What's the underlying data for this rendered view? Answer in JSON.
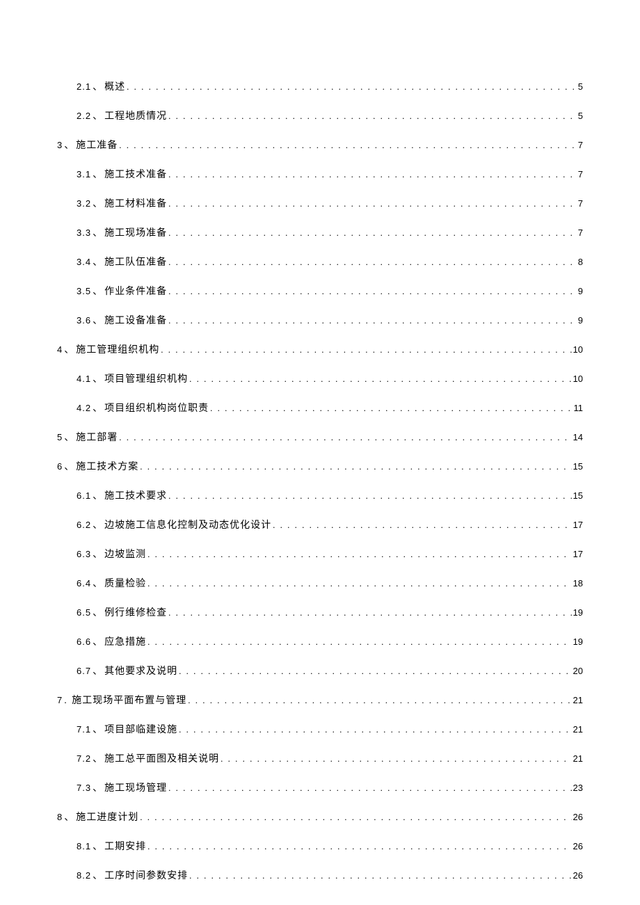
{
  "toc": [
    {
      "level": 2,
      "num": "2.1",
      "sep": "、",
      "title": "概述",
      "page": "5"
    },
    {
      "level": 2,
      "num": "2.2",
      "sep": "、",
      "title": "工程地质情况",
      "page": "5"
    },
    {
      "level": 1,
      "num": "3",
      "sep": "、",
      "title": "施工准备",
      "page": "7"
    },
    {
      "level": 2,
      "num": "3.1",
      "sep": "、",
      "title": "施工技术准备",
      "page": "7"
    },
    {
      "level": 2,
      "num": "3.2",
      "sep": "、",
      "title": "施工材料准备",
      "page": "7"
    },
    {
      "level": 2,
      "num": "3.3",
      "sep": "、",
      "title": "施工现场准备",
      "page": "7"
    },
    {
      "level": 2,
      "num": "3.4",
      "sep": "、",
      "title": "施工队伍准备",
      "page": "8"
    },
    {
      "level": 2,
      "num": "3.5",
      "sep": "、",
      "title": "作业条件准备",
      "page": "9"
    },
    {
      "level": 2,
      "num": "3.6",
      "sep": "、",
      "title": "施工设备准备",
      "page": "9"
    },
    {
      "level": 1,
      "num": "4",
      "sep": "、",
      "title": "施工管理组织机构",
      "page": "10"
    },
    {
      "level": 2,
      "num": "4.1",
      "sep": "、",
      "title": "项目管理组织机构",
      "page": "10"
    },
    {
      "level": 2,
      "num": "4.2",
      "sep": "、",
      "title": "项目组织机构岗位职责",
      "page": "11"
    },
    {
      "level": 1,
      "num": "5",
      "sep": "、",
      "title": "施工部署",
      "page": "14"
    },
    {
      "level": 1,
      "num": "6",
      "sep": "、",
      "title": "施工技术方案",
      "page": "15"
    },
    {
      "level": 2,
      "num": "6.1",
      "sep": "、",
      "title": "施工技术要求",
      "page": "15"
    },
    {
      "level": 2,
      "num": "6.2",
      "sep": "、",
      "title": "边坡施工信息化控制及动态优化设计",
      "page": "17"
    },
    {
      "level": 2,
      "num": "6.3",
      "sep": "、",
      "title": "边坡监测",
      "page": "17"
    },
    {
      "level": 2,
      "num": "6.4",
      "sep": "、",
      "title": "质量检验",
      "page": "18"
    },
    {
      "level": 2,
      "num": "6.5",
      "sep": "、",
      "title": "例行维修检查",
      "page": "19"
    },
    {
      "level": 2,
      "num": "6.6",
      "sep": "、",
      "title": "应急措施",
      "page": "19"
    },
    {
      "level": 2,
      "num": "6.7",
      "sep": "、",
      "title": "其他要求及说明",
      "page": "20"
    },
    {
      "level": 1,
      "num": "7",
      "sep": ".",
      "title": "施工现场平面布置与管理",
      "page": "21"
    },
    {
      "level": 2,
      "num": "7.1",
      "sep": "、",
      "title": "项目部临建设施",
      "page": "21"
    },
    {
      "level": 2,
      "num": "7.2",
      "sep": "、",
      "title": "施工总平面图及相关说明",
      "page": "21"
    },
    {
      "level": 2,
      "num": "7.3",
      "sep": "、",
      "title": "施工现场管理",
      "page": "23"
    },
    {
      "level": 1,
      "num": "8",
      "sep": "、",
      "title": "施工进度计划",
      "page": "26"
    },
    {
      "level": 2,
      "num": "8.1",
      "sep": "、",
      "title": "工期安排",
      "page": "26"
    },
    {
      "level": 2,
      "num": "8.2",
      "sep": "、",
      "title": "工序时间参数安排",
      "page": "26"
    }
  ],
  "dots": ". . . . . . . . . . . . . . . . . . . . . . . . . . . . . . . . . . . . . . . . . . . . . . . . . . . . . . . . . . . . . . . . . . . . . . . . . . . . . . . . . . . . . . . . . . . . . . . . . . . . . . . . . . . . . . . . . . . . . . . . . . . . . . . . . . . ."
}
